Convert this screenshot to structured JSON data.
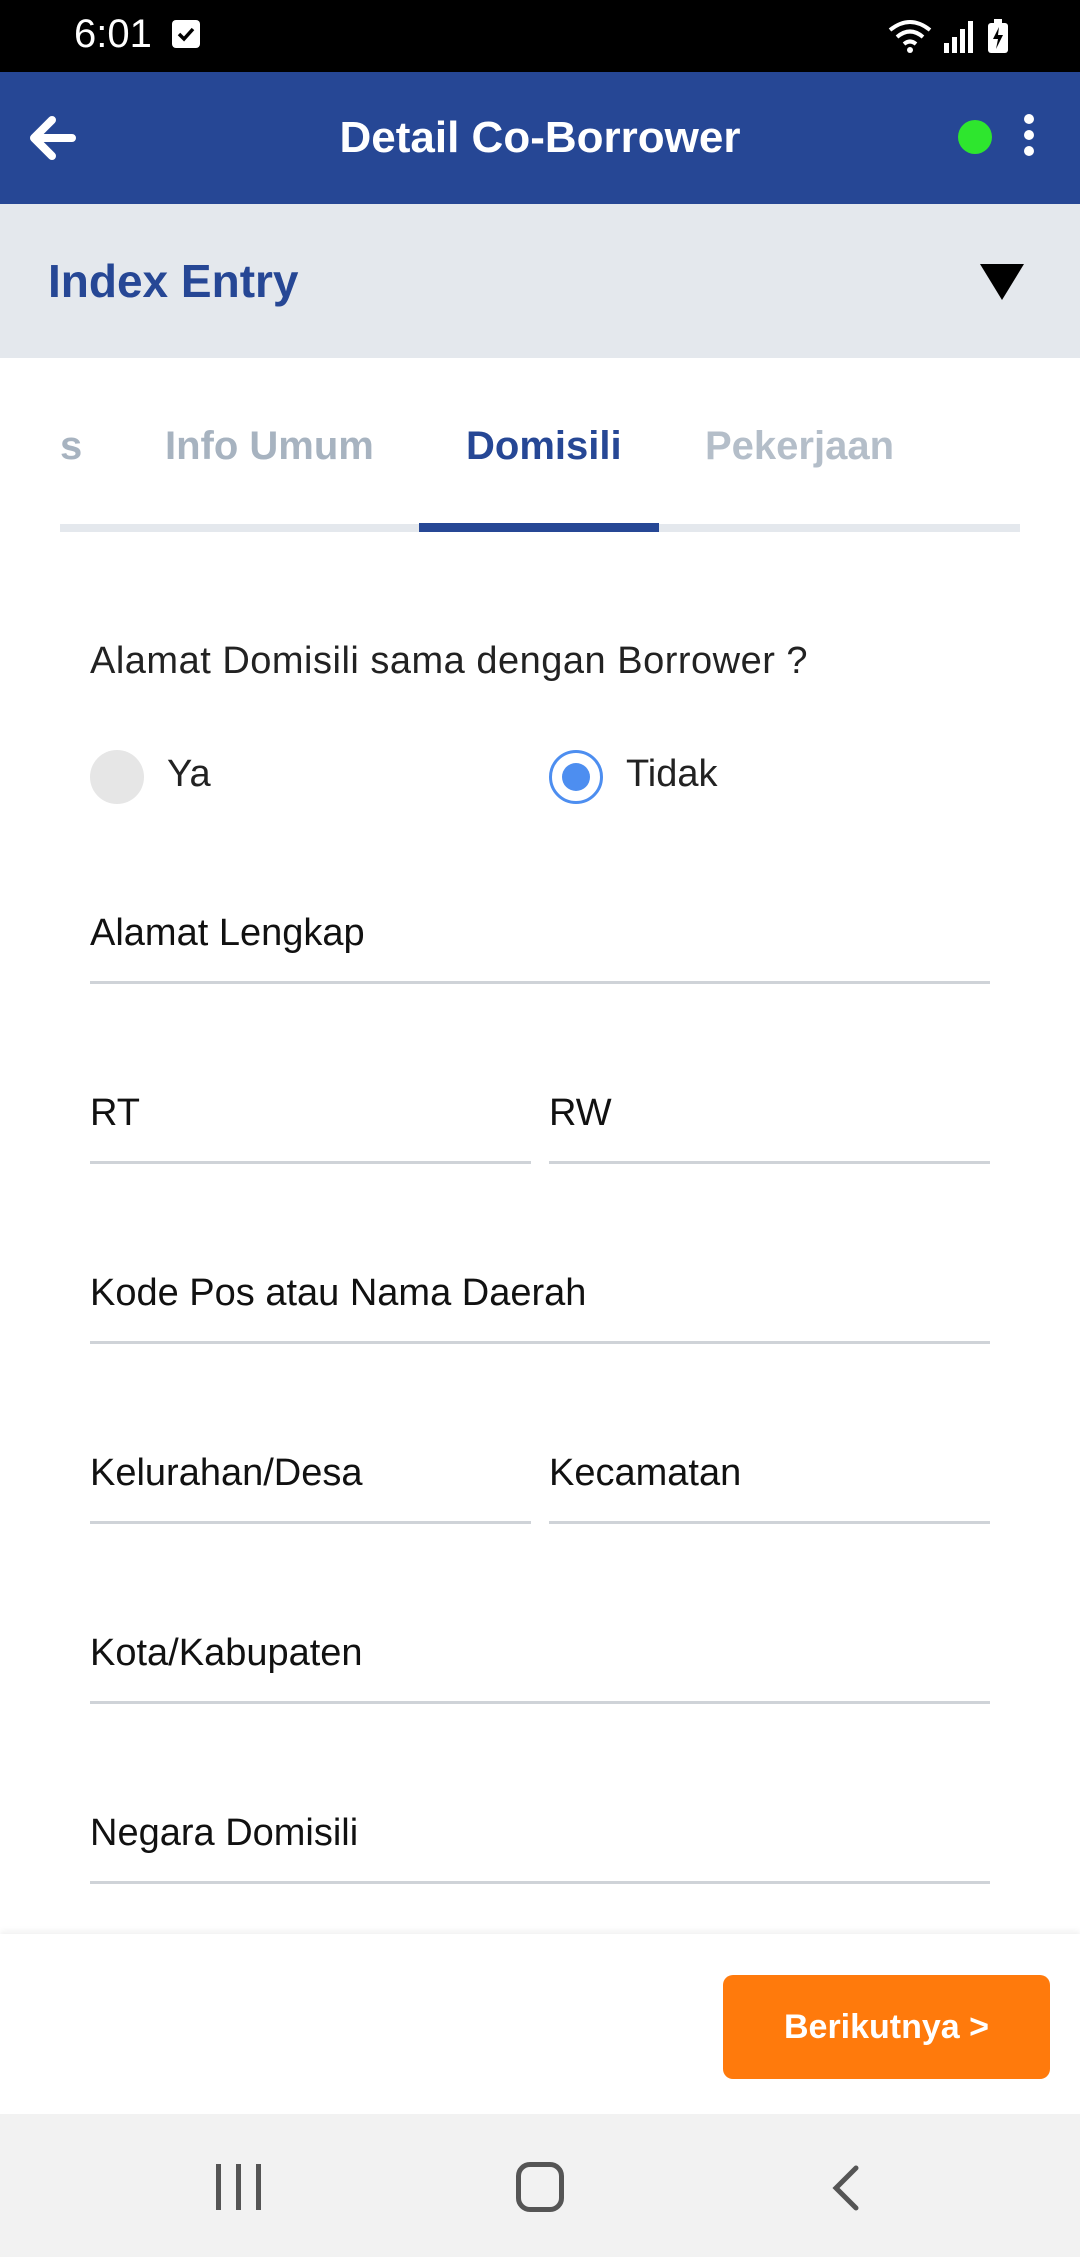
{
  "status_bar": {
    "time": "6:01",
    "icons": [
      "checkbox-notification-icon",
      "wifi-icon",
      "signal-icon",
      "battery-charging-icon"
    ]
  },
  "app_bar": {
    "title": "Detail Co-Borrower",
    "back_icon": "arrow-left-icon",
    "status_dot_color": "#2ee62e",
    "menu_icon": "more-vertical-icon"
  },
  "index_entry": {
    "label": "Index Entry",
    "toggle_icon": "triangle-down-icon"
  },
  "tabs": [
    {
      "label": "s",
      "active": false
    },
    {
      "label": "Info Umum",
      "active": false
    },
    {
      "label": "Domisili",
      "active": true
    },
    {
      "label": "Pekerjaan",
      "active": false
    }
  ],
  "form": {
    "question": "Alamat Domisili sama dengan Borrower ?",
    "options": [
      {
        "label": "Ya",
        "selected": false
      },
      {
        "label": "Tidak",
        "selected": true
      }
    ],
    "fields": {
      "alamat_lengkap": "Alamat Lengkap",
      "rt": "RT",
      "rw": "RW",
      "kode_pos": "Kode Pos atau Nama Daerah",
      "kelurahan": "Kelurahan/Desa",
      "kecamatan": "Kecamatan",
      "kota": "Kota/Kabupaten",
      "negara": "Negara Domisili"
    }
  },
  "actions": {
    "next_label": "Berikutnya >"
  },
  "colors": {
    "primary": "#264795",
    "accent": "#ff7a0c",
    "radio": "#4d8ef0",
    "header_bg": "#e4e8ed"
  }
}
